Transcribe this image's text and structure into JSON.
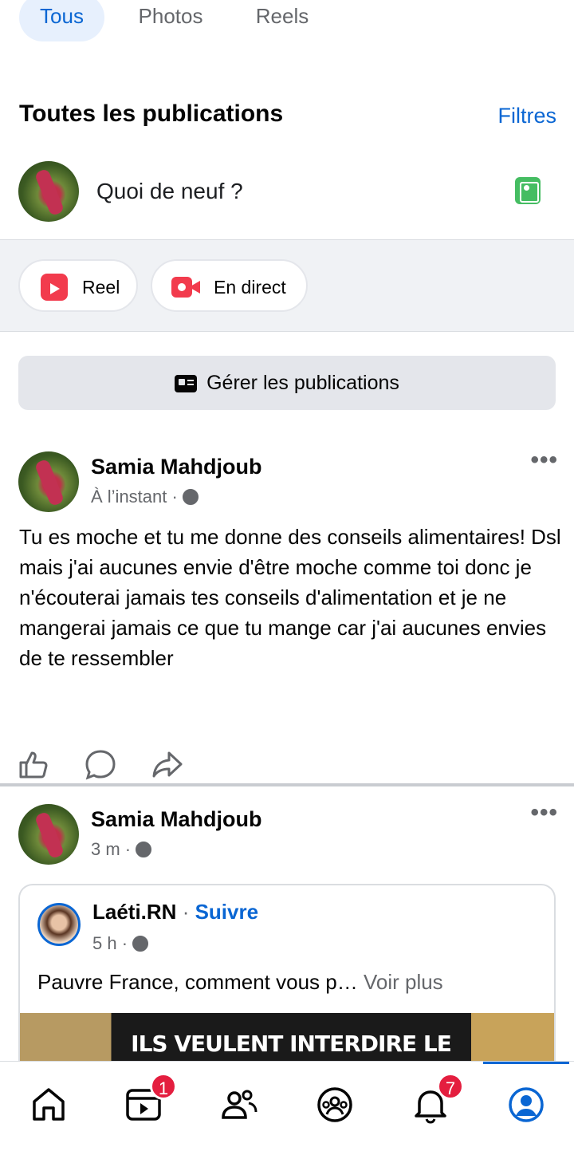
{
  "tabs": [
    {
      "label": "Tous",
      "active": true
    },
    {
      "label": "Photos",
      "active": false
    },
    {
      "label": "Reels",
      "active": false
    }
  ],
  "section": {
    "title": "Toutes les publications",
    "filters_label": "Filtres"
  },
  "composer": {
    "placeholder": "Quoi de neuf ?",
    "photo_icon": "photo-icon"
  },
  "actions": {
    "reel_label": "Reel",
    "live_label": "En direct"
  },
  "manage": {
    "label": "Gérer les publications"
  },
  "posts": [
    {
      "author": "Samia Mahdjoub",
      "time": "À l’instant",
      "text": "Tu es moche et tu me donne des conseils alimentaires! Dsl mais j'ai aucunes envie d'être moche comme toi donc je n'écouterai jamais tes conseils d'alimentation et je ne mangerai jamais ce que tu mange car j'ai aucunes envies de te ressembler"
    },
    {
      "author": "Samia Mahdjoub",
      "time": "3 m",
      "shared": {
        "author": "Laéti.RN",
        "follow_label": "Suivre",
        "time": "5 h",
        "text": "Pauvre France, comment vous p…",
        "more_label": "Voir plus",
        "image_headline": "ILS VEULENT INTERDIRE LE VOILE,"
      }
    }
  ],
  "bottom_nav": {
    "video_badge": "1",
    "notifications_badge": "7"
  },
  "colors": {
    "accent": "#0a66d3",
    "badge": "#e41e3f",
    "live_red": "#f23b4d",
    "photo_green": "#45bd62"
  }
}
